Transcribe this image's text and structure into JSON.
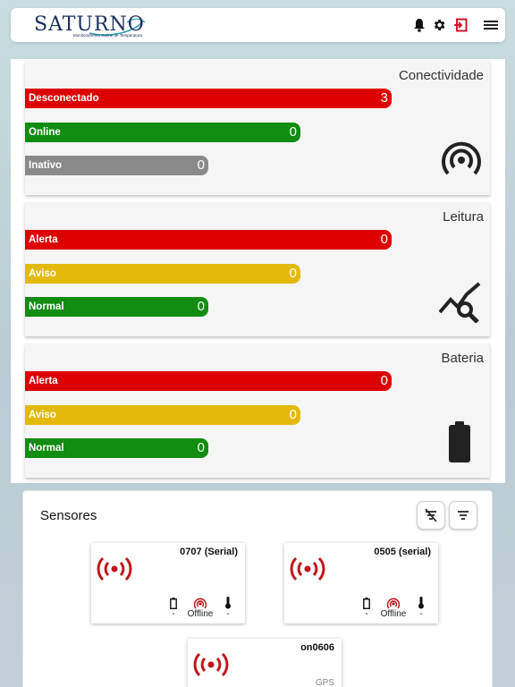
{
  "header": {
    "logo_text": "SATURNO",
    "logo_subtitle": "Monitoramento Online de Temperatura",
    "icons": [
      "bell-icon",
      "gear-icon",
      "logout-icon",
      "menu-icon"
    ],
    "logout_color": "#d0021b"
  },
  "cards": [
    {
      "title": "Conectividade",
      "icon": "signal-icon",
      "bars": [
        {
          "label": "Desconectado",
          "value": "3",
          "color": "#dd0000"
        },
        {
          "label": "Online",
          "value": "0",
          "color": "#118d11"
        },
        {
          "label": "Inativo",
          "value": "0",
          "color": "#8a8a8a"
        }
      ]
    },
    {
      "title": "Leitura",
      "icon": "chart-search-icon",
      "bars": [
        {
          "label": "Alerta",
          "value": "0",
          "color": "#dd0000"
        },
        {
          "label": "Aviso",
          "value": "0",
          "color": "#e3b90a"
        },
        {
          "label": "Normal",
          "value": "0",
          "color": "#118d11"
        }
      ]
    },
    {
      "title": "Bateria",
      "icon": "battery-icon",
      "bars": [
        {
          "label": "Alerta",
          "value": "0",
          "color": "#dd0000"
        },
        {
          "label": "Aviso",
          "value": "0",
          "color": "#e3b90a"
        },
        {
          "label": "Normal",
          "value": "0",
          "color": "#118d11"
        }
      ]
    }
  ],
  "sensors": {
    "title": "Sensores",
    "buttons": [
      "clear-filter-icon",
      "filter-icon"
    ],
    "items": [
      {
        "name": "0707 (Serial)",
        "battery": "-",
        "status": "Offline",
        "temperature": "-"
      },
      {
        "name": "0505 (serial)",
        "battery": "-",
        "status": "Offline",
        "temperature": "-"
      },
      {
        "name": "on0606",
        "gps": "GPS"
      }
    ],
    "signal_color": "#c0151b"
  }
}
